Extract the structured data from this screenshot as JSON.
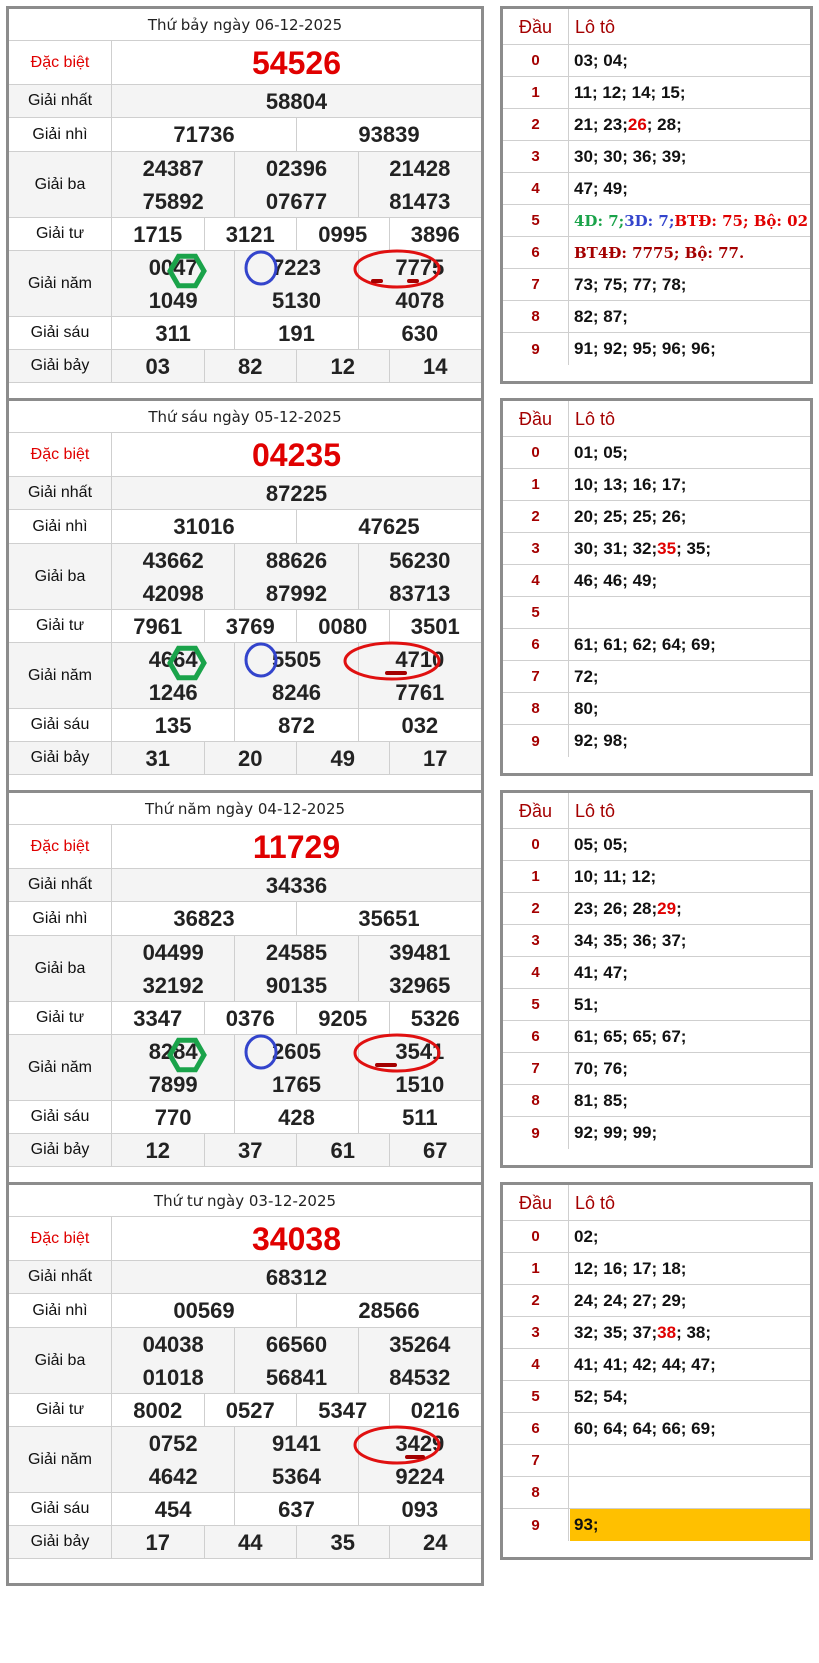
{
  "labels": {
    "special": "Đặc biệt",
    "first": "Giải nhất",
    "second": "Giải nhì",
    "third": "Giải ba",
    "fourth": "Giải tư",
    "fifth": "Giải năm",
    "sixth": "Giải sáu",
    "seventh": "Giải bảy",
    "head": "Đầu",
    "loto": "Lô tô"
  },
  "days": [
    {
      "title": "Thứ bảy ngày 06-12-2025",
      "special": "54526",
      "first": [
        "58804"
      ],
      "second": [
        "71736",
        "93839"
      ],
      "third": [
        "24387",
        "02396",
        "21428",
        "75892",
        "07677",
        "81473"
      ],
      "fourth": [
        "1715",
        "3121",
        "0995",
        "3896"
      ],
      "fifth": [
        "0047",
        "7223",
        "7775",
        "1049",
        "5130",
        "4078"
      ],
      "sixth": [
        "311",
        "191",
        "630"
      ],
      "seventh": [
        "03",
        "82",
        "12",
        "14"
      ],
      "loto": [
        "03; 04;",
        "11; 12; 14; 15;",
        "21; 23; |26|; 28;",
        "30; 30; 36; 39;",
        "47; 49;",
        "",
        "",
        "73; 75; 77; 78;",
        "82; 87;",
        "91; 92; 95; 96; 96;"
      ],
      "loto_note5": [
        {
          "text": "4D: 7; ",
          "color": "#1aa34a"
        },
        {
          "text": "3D: 7; ",
          "color": "#3344cc"
        },
        {
          "text": "BTĐ: 75; Bộ: 02",
          "color": "#e00000"
        }
      ],
      "loto_note6": [
        {
          "text": "BT4Đ: 7775; Bộ: 77.",
          "color": "#a40000"
        }
      ]
    },
    {
      "title": "Thứ sáu ngày 05-12-2025",
      "special": "04235",
      "first": [
        "87225"
      ],
      "second": [
        "31016",
        "47625"
      ],
      "third": [
        "43662",
        "88626",
        "56230",
        "42098",
        "87992",
        "83713"
      ],
      "fourth": [
        "7961",
        "3769",
        "0080",
        "3501"
      ],
      "fifth": [
        "4664",
        "5505",
        "4710",
        "1246",
        "8246",
        "7761"
      ],
      "sixth": [
        "135",
        "872",
        "032"
      ],
      "seventh": [
        "31",
        "20",
        "49",
        "17"
      ],
      "loto": [
        "01; 05;",
        "10; 13; 16; 17;",
        "20; 25; 25; 26;",
        "30; 31; 32; |35|; 35;",
        "46; 46; 49;",
        "",
        "61; 61; 62; 64; 69;",
        "72;",
        "80;",
        "92; 98;"
      ]
    },
    {
      "title": "Thứ năm ngày 04-12-2025",
      "special": "11729",
      "first": [
        "34336"
      ],
      "second": [
        "36823",
        "35651"
      ],
      "third": [
        "04499",
        "24585",
        "39481",
        "32192",
        "90135",
        "32965"
      ],
      "fourth": [
        "3347",
        "0376",
        "9205",
        "5326"
      ],
      "fifth": [
        "8284",
        "2605",
        "3541",
        "7899",
        "1765",
        "1510"
      ],
      "sixth": [
        "770",
        "428",
        "511"
      ],
      "seventh": [
        "12",
        "37",
        "61",
        "67"
      ],
      "loto": [
        "05; 05;",
        "10; 11; 12;",
        "23; 26; 28; |29|;",
        "34; 35; 36; 37;",
        "41; 47;",
        "51;",
        "61; 65; 65; 67;",
        "70; 76;",
        "81; 85;",
        "92; 99; 99;"
      ]
    },
    {
      "title": "Thứ tư ngày 03-12-2025",
      "special": "34038",
      "first": [
        "68312"
      ],
      "second": [
        "00569",
        "28566"
      ],
      "third": [
        "04038",
        "66560",
        "35264",
        "01018",
        "56841",
        "84532"
      ],
      "fourth": [
        "8002",
        "0527",
        "5347",
        "0216"
      ],
      "fifth": [
        "0752",
        "9141",
        "3429",
        "4642",
        "5364",
        "9224"
      ],
      "sixth": [
        "454",
        "637",
        "093"
      ],
      "seventh": [
        "17",
        "44",
        "35",
        "24"
      ],
      "loto": [
        "02;",
        "12; 16; 17; 18;",
        "24; 24; 27; 29;",
        "32; 35; 37; |38|; 38;",
        "41; 41; 42; 44; 47;",
        "52; 54;",
        "60; 64; 64; 66; 69;",
        "",
        "",
        "93;"
      ],
      "loto_highlight": 9
    }
  ]
}
